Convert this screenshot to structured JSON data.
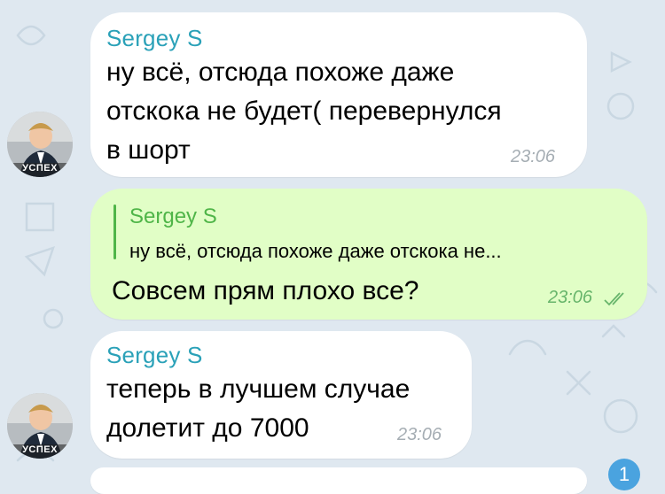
{
  "chat": {
    "messages": [
      {
        "sender": "Sergey S",
        "lines": [
          "ну всё, отсюда похоже даже",
          "отскока не будет( перевернулся",
          "в шорт"
        ],
        "time": "23:06"
      },
      {
        "reply_to": {
          "sender": "Sergey S",
          "preview": "ну всё, отсюда похоже даже отскока не..."
        },
        "text": "Совсем прям плохо все?",
        "time": "23:06"
      },
      {
        "sender": "Sergey S",
        "lines": [
          "теперь в лучшем случае",
          "долетит до 7000"
        ],
        "time": "23:06"
      }
    ],
    "avatar_caption": "УСПЕХ",
    "unread_badge": "1"
  },
  "colors": {
    "background": "#dfe8f0",
    "incoming_bubble": "#ffffff",
    "outgoing_bubble": "#e1fec6",
    "sender_name": "#2aa1b8",
    "reply_accent": "#4fb548"
  }
}
